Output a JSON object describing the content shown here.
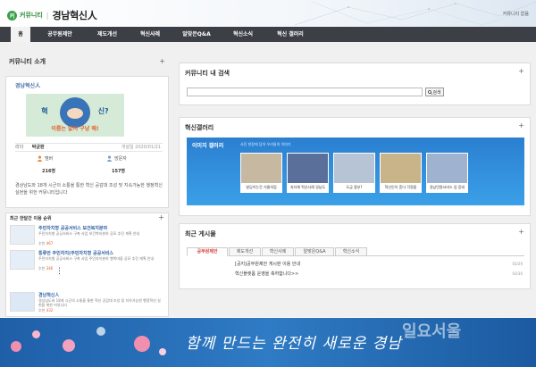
{
  "header": {
    "logo_mark": "커",
    "logo_label": "커뮤니티",
    "separator": "|",
    "site_title": "경남혁신人",
    "top_right_link": "커뮤니티 없음"
  },
  "nav": {
    "items": [
      {
        "label": "홈"
      },
      {
        "label": "공무원제안"
      },
      {
        "label": "제도개선"
      },
      {
        "label": "혁신사례"
      },
      {
        "label": "알맞은Q&A"
      },
      {
        "label": "혁신소식"
      },
      {
        "label": "혁신 갤러리"
      }
    ]
  },
  "left": {
    "intro_title": "커뮤니티 소개",
    "plus": "+",
    "community_name": "경남혁신人",
    "image_text_left": "혁",
    "image_text_right": "신?",
    "image_caption": "이름는 없어 구냥 해!",
    "leader_key": "리더",
    "leader_value": "박균판",
    "created_date": "개설일 2020/01/21",
    "member_label": "멤버",
    "visitor_label": "방문자",
    "member_count": "216명",
    "visitor_count": "157명",
    "description": "경상남도와 18개 시군의 소통을 통한 혁신 공감대 조성 및 지속가능한 행정혁신 실현을 위한 커뮤니티입니다",
    "recent_title": "최근 한달간 이용 순위",
    "recent_items": [
      {
        "title": "주민자치형 공공서비스 보건복지분야",
        "desc": "주민자치형 공공서비스 구축 사업 보건복지분야 공모 추진 계획 안내",
        "meta_prefix": "추천",
        "meta_hot": "467",
        "thumb_color": "#e9eef4"
      },
      {
        "title": "통류안 주민자치(주민자치형 공공서비스",
        "desc": "주민자치형 공공서비스 구축 사업 주민자치분야 행복마을 공모 추진 계획 안내",
        "meta_prefix": "추천",
        "meta_hot": "346",
        "thumb_color": "#e4eef8"
      },
      {
        "title": "경남혁신人",
        "desc": "경상남도와 18개 시군의 소통을 통한 혁신 공감대 조성 및 지속가능한 행정혁신 실현을 위한 커뮤니티",
        "meta_prefix": "추천",
        "meta_hot": "432",
        "thumb_color": "#dce8f6"
      }
    ],
    "dots": "⋮"
  },
  "right": {
    "search_title": "커뮤니티 내 검색",
    "search_placeholder": "",
    "search_button": "검색",
    "gallery_title": "혁신갤러리",
    "gallery_label": "이미지 갤러리",
    "gallery_sub": "사진 한장에 담아 우리들의 이야기",
    "gallery_items": [
      {
        "caption": "빌딩이는건 거물의집",
        "color": "#c7b9a1"
      },
      {
        "caption": "지자체 혁신사례 경남도",
        "color": "#5a6f99"
      },
      {
        "caption": "도금 중부?",
        "color": "#b7c4d6"
      },
      {
        "caption": "혁신인이 혼다 걱정을",
        "color": "#c9b48a"
      },
      {
        "caption": "경남민원서비스 업 증대",
        "color": "#9fb3d1"
      }
    ],
    "board_title": "최근 게시물",
    "tabs": [
      {
        "label": "공무원제안"
      },
      {
        "label": "제도개선"
      },
      {
        "label": "혁신사례"
      },
      {
        "label": "알맞은Q&A"
      },
      {
        "label": "혁신소식"
      }
    ],
    "posts": [
      {
        "title": "[공지]공무원제안 게시판 이용 안내",
        "date": "03/29"
      },
      {
        "title": "혁신플랫폼 운영을 축하합니다>>",
        "date": "03/30"
      }
    ],
    "plus": "+"
  },
  "banner": {
    "slogan": "함께 만드는 완전히 새로운 경남",
    "watermark": "일요서울"
  }
}
